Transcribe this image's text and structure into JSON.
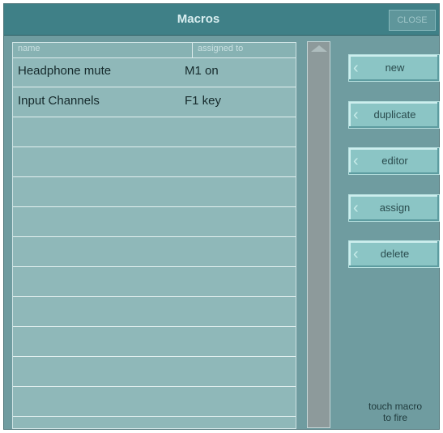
{
  "window": {
    "title": "Macros",
    "close_label": "CLOSE"
  },
  "list": {
    "columns": [
      "name",
      "assigned to"
    ],
    "rows": [
      {
        "name": "Headphone mute",
        "assigned_to": "M1 on"
      },
      {
        "name": "Input Channels",
        "assigned_to": "F1 key"
      },
      {
        "name": "",
        "assigned_to": ""
      },
      {
        "name": "",
        "assigned_to": ""
      },
      {
        "name": "",
        "assigned_to": ""
      },
      {
        "name": "",
        "assigned_to": ""
      },
      {
        "name": "",
        "assigned_to": ""
      },
      {
        "name": "",
        "assigned_to": ""
      },
      {
        "name": "",
        "assigned_to": ""
      },
      {
        "name": "",
        "assigned_to": ""
      },
      {
        "name": "",
        "assigned_to": ""
      },
      {
        "name": "",
        "assigned_to": ""
      }
    ]
  },
  "buttons": {
    "new": "new",
    "duplicate": "duplicate",
    "editor": "editor",
    "assign": "assign",
    "delete": "delete"
  },
  "hint": {
    "line1": "touch macro",
    "line2": "to fire"
  },
  "colors": {
    "titlebar": "#3f8087",
    "panel": "#6f9ca0",
    "list_bg": "#8fb8b9",
    "button": "#8bc5c5"
  },
  "icons": {
    "button_chevron": "chevron-left-icon",
    "scroll_up": "scroll-up-arrow-icon"
  }
}
